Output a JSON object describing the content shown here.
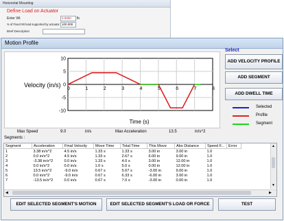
{
  "bg_window": {
    "title": "Horizontal Mounting",
    "heading": "Define Load on Actuator",
    "enter_wt_label": "Enter Wt",
    "enter_wt_value": "0.0000",
    "enter_wt_unit": "lb",
    "percent_label": "% of Fixed Wt load supported by actuator",
    "percent_value": "100.000",
    "brief_label": "Brief Description"
  },
  "dialog": {
    "title": "Motion Profile"
  },
  "select_label": "Select",
  "buttons": {
    "add_velocity_profile": "ADD VELOCITY PROFILE",
    "add_segment": "ADD SEGMENT",
    "add_dwell_time": "ADD DWELL TIME",
    "edit_motion": "EDIT SELECTED SEGMENT'S MOTION",
    "edit_load": "EDIT SELECTED SEGMENT'S LOAD OR FORCE",
    "test": "TEST"
  },
  "legend": [
    {
      "label": "Selected",
      "color": "#1c1cd4"
    },
    {
      "label": "Profile",
      "color": "#e02020"
    },
    {
      "label": "Segment",
      "color": "#1cd41c"
    }
  ],
  "summary": {
    "max_speed_label": "Max Speed",
    "max_speed_value": "9.0",
    "max_speed_unit": "in/s",
    "max_accel_label": "Max Acceleration",
    "max_accel_value": "13.5",
    "max_accel_unit": "in/s^2"
  },
  "segments_label": "Segments :",
  "table": {
    "headers": [
      "Segment",
      "Acceleration",
      "Final Velocity",
      "Move Time",
      "Total Time",
      "This Move",
      "Abs Distance",
      "Speed F...",
      "Error"
    ],
    "rows": [
      [
        "1",
        "3.38 in/s^2",
        "4.5 in/s",
        "1.33 s",
        "1.33 s",
        "3.00 in",
        "3.00 in",
        "1.0",
        ""
      ],
      [
        "2",
        "0.0 in/s^2",
        "4.5 in/s",
        "1.33 s",
        "2.67 s",
        "6.00 in",
        "9.00 in",
        "1.0",
        ""
      ],
      [
        "3",
        "-3.38 in/s^2",
        "0.0 in/s",
        "1.33 s",
        "4.0 s",
        "3.00 in",
        "12.00 in",
        "1.0",
        ""
      ],
      [
        "4",
        "0.0 in/s^2",
        "0.0 in/s",
        "1.0 s",
        "5.0 s",
        "0.00 in",
        "12.00 in",
        "1.0",
        ""
      ],
      [
        "5",
        "13.5 in/s^2",
        "-9.0 in/s",
        "0.67 s",
        "5.67 s",
        "-3.00 in",
        "9.00 in",
        "1.0",
        ""
      ],
      [
        "6",
        "0.0 in/s^2",
        "-9.0 in/s",
        "0.67 s",
        "6.33 s",
        "-6.00 in",
        "3.00 in",
        "1.0",
        ""
      ],
      [
        "7",
        "-13.5 in/s^2",
        "0.0 in/s",
        "0.67 s",
        "7.0 s",
        "-3.00 in",
        "0.00 in",
        "1.0",
        ""
      ]
    ]
  },
  "chart_data": {
    "type": "line",
    "xlabel": "Time (s)",
    "ylabel": "Velocity (in/s)",
    "xlim": [
      0,
      8
    ],
    "ylim": [
      -10,
      10
    ],
    "xticks": [
      0,
      1,
      2,
      3,
      4,
      5,
      6,
      7,
      8
    ],
    "yticks": [
      -10,
      -5,
      0,
      5,
      10
    ],
    "grid": true,
    "series": [
      {
        "color": "#e02020",
        "x": [
          0,
          1.33,
          2.67,
          4.0,
          5.0,
          5.67,
          6.33,
          7.0
        ],
        "y": [
          0,
          4.5,
          4.5,
          0,
          0,
          -9,
          -9,
          0
        ]
      },
      {
        "color": "#1cd41c",
        "x": [
          4.0,
          5.0
        ],
        "y": [
          0,
          0
        ]
      },
      {
        "color": "#1cd41c",
        "x": [
          7.0,
          7.33
        ],
        "y": [
          0,
          0
        ]
      }
    ]
  }
}
